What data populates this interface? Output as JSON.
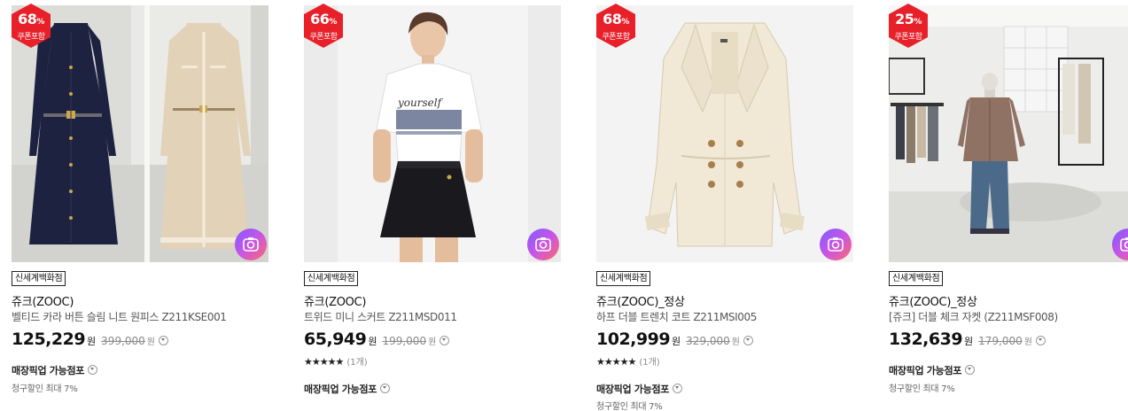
{
  "colors": {
    "badge_red": "#e8202a",
    "price_text": "#111111",
    "original_price": "#888888",
    "camera_gradient": [
      "#7b5cff",
      "#c855e6",
      "#ff6a6a"
    ]
  },
  "products": [
    {
      "discount_rate": "68",
      "discount_unit": "%",
      "coupon_label": "쿠폰포함",
      "store_tag": "신세계백화점",
      "brand": "쥬크(ZOOC)",
      "name": "벨티드 카라 버튼 슬림 니트 원피스 Z211KSE001",
      "price": "125,229",
      "price_unit": "원",
      "original_price": "399,000",
      "original_unit": "원",
      "pickup_label": "매장픽업 가능점포",
      "card_discount": "청구할인 최대 7%"
    },
    {
      "discount_rate": "66",
      "discount_unit": "%",
      "coupon_label": "쿠폰포함",
      "store_tag": "신세계백화점",
      "brand": "쥬크(ZOOC)",
      "name": "트위드 미니 스커트 Z211MSD011",
      "price": "65,949",
      "price_unit": "원",
      "original_price": "199,000",
      "original_unit": "원",
      "stars": "★★★★★",
      "review_count": "(1개)",
      "pickup_label": "매장픽업 가능점포"
    },
    {
      "discount_rate": "68",
      "discount_unit": "%",
      "coupon_label": "쿠폰포함",
      "store_tag": "신세계백화점",
      "brand": "쥬크(ZOOC)_정상",
      "name": "하프 더블 트렌치 코트 Z211MSI005",
      "price": "102,999",
      "price_unit": "원",
      "original_price": "329,000",
      "original_unit": "원",
      "stars": "★★★★★",
      "review_count": "(1개)",
      "pickup_label": "매장픽업 가능점포",
      "card_discount": "청구할인 최대 7%"
    },
    {
      "discount_rate": "25",
      "discount_unit": "%",
      "coupon_label": "쿠폰포함",
      "store_tag": "신세계백화점",
      "brand": "쥬크(ZOOC)_정상",
      "name": "[쥬크] 더블 체크 자켓 (Z211MSF008)",
      "price": "132,639",
      "price_unit": "원",
      "original_price": "179,000",
      "original_unit": "원",
      "pickup_label": "매장픽업 가능점포",
      "card_discount": "청구할인 최대 7%"
    }
  ]
}
